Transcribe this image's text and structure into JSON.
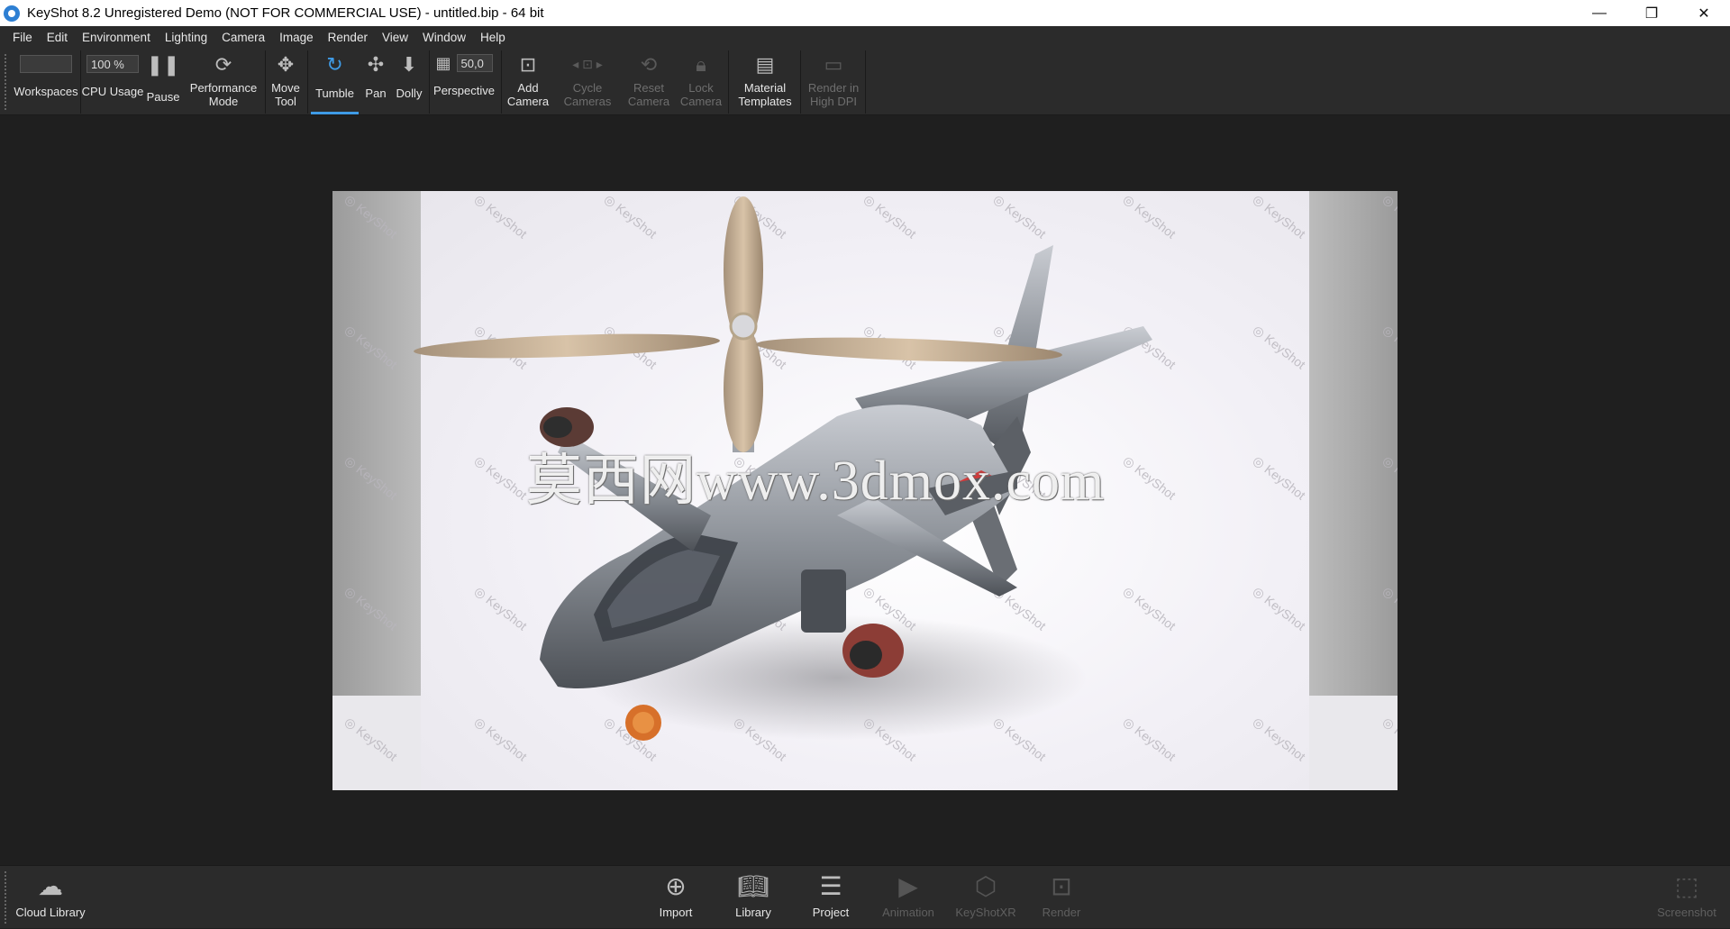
{
  "window": {
    "title": "KeyShot 8.2 Unregistered Demo (NOT FOR COMMERCIAL USE) - untitled.bip  - 64 bit",
    "minimize": "—",
    "maximize": "❐",
    "close": "✕"
  },
  "menu": [
    "File",
    "Edit",
    "Environment",
    "Lighting",
    "Camera",
    "Image",
    "Render",
    "View",
    "Window",
    "Help"
  ],
  "toolbar": {
    "workspaces": "Workspaces",
    "cpu_usage_value": "100 %",
    "cpu_usage": "CPU Usage",
    "pause": "Pause",
    "performance_mode": "Performance Mode",
    "move_tool": "Move Tool",
    "tumble": "Tumble",
    "pan": "Pan",
    "dolly": "Dolly",
    "fov_value": "50,0",
    "perspective": "Perspective",
    "add_camera": "Add Camera",
    "cycle_cameras": "Cycle Cameras",
    "reset_camera": "Reset Camera",
    "lock_camera": "Lock Camera",
    "material_templates": "Material Templates",
    "render_high_dpi": "Render in High DPI"
  },
  "viewport": {
    "watermark": "KeyShot",
    "overlay_text": "莫西网www.3dmox.com"
  },
  "bottombar": {
    "cloud_library": "Cloud Library",
    "import": "Import",
    "library": "Library",
    "project": "Project",
    "animation": "Animation",
    "keyshotxr": "KeyShotXR",
    "render": "Render",
    "screenshot": "Screenshot"
  },
  "colors": {
    "accent": "#3f9be6",
    "panel": "#2b2b2b",
    "background": "#1f1f1f"
  }
}
